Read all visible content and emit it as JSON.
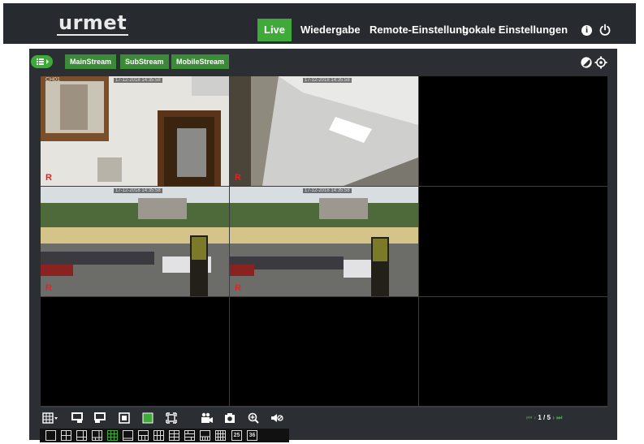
{
  "app": {
    "logo": "urmet"
  },
  "nav": {
    "items": [
      {
        "label": "Live",
        "active": true
      },
      {
        "label": "Wiedergabe",
        "active": false
      },
      {
        "label": "Remote-Einstellung",
        "active": false
      },
      {
        "label": "Lokale Einstellungen",
        "active": false
      }
    ],
    "icons": [
      "info-icon",
      "power-icon"
    ]
  },
  "streams": {
    "main": "MainStream",
    "sub": "SubStream",
    "mobile": "MobileStream"
  },
  "channels": [
    {
      "label": "CH01",
      "timestamp": "17-12-2018 14:35:58",
      "recording": "R"
    },
    {
      "label": "",
      "timestamp": "17-12-2018 14:35:58",
      "recording": "R"
    },
    {
      "label": "",
      "timestamp": "",
      "recording": ""
    },
    {
      "label": "CH03",
      "timestamp": "17-12-2018 14:35:58",
      "recording": "R"
    },
    {
      "label": "CH04",
      "timestamp": "17-12-2018 14:35:58",
      "recording": "R"
    },
    {
      "label": "",
      "timestamp": "",
      "recording": ""
    },
    {
      "label": "",
      "timestamp": "",
      "recording": ""
    },
    {
      "label": "",
      "timestamp": "",
      "recording": ""
    },
    {
      "label": "",
      "timestamp": "",
      "recording": ""
    }
  ],
  "toolbar": {
    "icons": [
      "layout-grid-icon",
      "previous-screen-icon",
      "next-screen-icon",
      "single-view-icon",
      "green-view-icon",
      "fullscreen-icon",
      "record-icon",
      "snapshot-icon",
      "zoom-icon",
      "audio-icon"
    ]
  },
  "pager": {
    "current": "1",
    "separator": "/",
    "total": "5"
  },
  "layouts": {
    "counts": [
      "25",
      "36"
    ]
  },
  "colors": {
    "accent": "#3faa3a",
    "topbar": "#272b30",
    "panel": "#2b2f34",
    "recording": "#e52222"
  }
}
